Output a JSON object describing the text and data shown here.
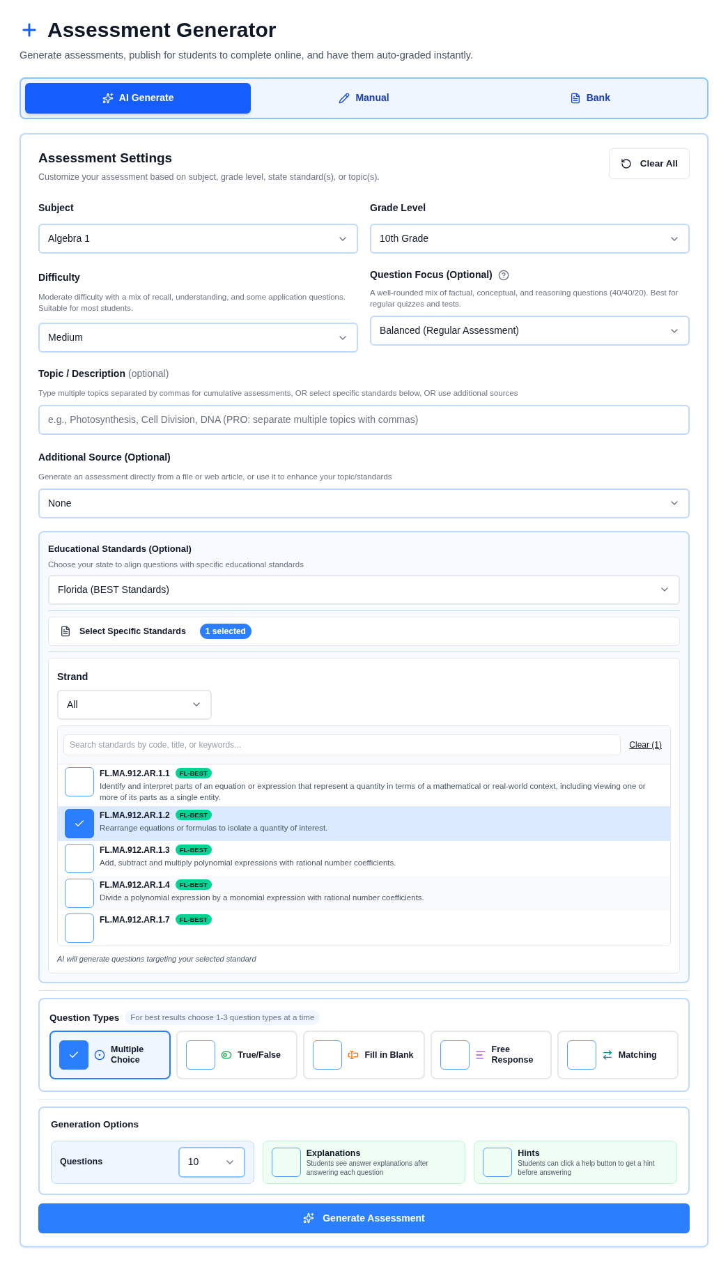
{
  "header": {
    "title": "Assessment Generator",
    "subtitle": "Generate assessments, publish for students to complete online, and have them auto-graded instantly."
  },
  "tabs": [
    {
      "label": "AI Generate",
      "kind": "ai",
      "selected": true
    },
    {
      "label": "Manual",
      "kind": "manual",
      "selected": false
    },
    {
      "label": "Bank",
      "kind": "bank",
      "selected": false
    }
  ],
  "settings": {
    "title": "Assessment Settings",
    "subtitle": "Customize your assessment based on subject, grade level, state standard(s), or topic(s).",
    "clear_button": "Clear All"
  },
  "subject": {
    "label": "Subject",
    "value": "Algebra 1"
  },
  "grade_level": {
    "label": "Grade Level",
    "value": "10th Grade"
  },
  "difficulty": {
    "label": "Difficulty",
    "description": "Moderate difficulty with a mix of recall, understanding, and some application questions. Suitable for most students.",
    "value": "Medium"
  },
  "question_focus": {
    "label": "Question Focus (Optional)",
    "description": "A well-rounded mix of factual, conceptual, and reasoning questions (40/40/20). Best for regular quizzes and tests.",
    "value": "Balanced (Regular Assessment)"
  },
  "topic": {
    "label": "Topic / Description",
    "hint": "(optional)",
    "description": "Type multiple topics separated by commas for cumulative assessments, OR select specific standards below, OR use additional sources",
    "placeholder": "e.g., Photosynthesis, Cell Division, DNA (PRO: separate multiple topics with commas)"
  },
  "additional_source": {
    "label": "Additional Source (Optional)",
    "description": "Generate an assessment directly from a file or web article, or use it to enhance your topic/standards",
    "value": "None"
  },
  "standards": {
    "title": "Educational Standards (Optional)",
    "description": "Choose your state to align questions with specific educational standards",
    "state": "Florida (BEST Standards)",
    "select_label": "Select Specific Standards",
    "selected_count": "1 selected",
    "strand_label": "Strand",
    "strand_value": "All",
    "search_placeholder": "Search standards by code, title, or keywords...",
    "clear_link": "Clear (1)",
    "items": [
      {
        "code": "FL.MA.912.AR.1.1",
        "tag": "FL-BEST",
        "description": "Identify and interpret parts of an equation or expression that represent a quantity in terms of a mathematical or real-world context, including viewing one or more of its parts as a single entity.",
        "selected": false
      },
      {
        "code": "FL.MA.912.AR.1.2",
        "tag": "FL-BEST",
        "description": "Rearrange equations or formulas to isolate a quantity of interest.",
        "selected": true
      },
      {
        "code": "FL.MA.912.AR.1.3",
        "tag": "FL-BEST",
        "description": "Add, subtract and multiply polynomial expressions with rational number coefficients.",
        "selected": false
      },
      {
        "code": "FL.MA.912.AR.1.4",
        "tag": "FL-BEST",
        "description": "Divide a polynomial expression by a monomial expression with rational number coefficients.",
        "selected": false
      },
      {
        "code": "FL.MA.912.AR.1.7",
        "tag": "FL-BEST",
        "selected": false
      }
    ],
    "footnote": "AI will generate questions targeting your selected standard"
  },
  "question_types": {
    "title": "Question Types",
    "hint": "For best results choose 1-3 question types at a time",
    "items": [
      {
        "label": "Multiple Choice",
        "kind": "multiple_choice",
        "selected": true
      },
      {
        "label": "True/False",
        "kind": "true_false",
        "selected": false
      },
      {
        "label": "Fill in Blank",
        "kind": "fill_blank",
        "selected": false
      },
      {
        "label": "Free Response",
        "kind": "free_response",
        "selected": false
      },
      {
        "label": "Matching",
        "kind": "matching",
        "selected": false
      }
    ]
  },
  "generation_options": {
    "title": "Generation Options",
    "questions_label": "Questions",
    "questions_value": "10",
    "toggles": [
      {
        "label": "Explanations",
        "description": "Students see answer explanations after answering each question",
        "checked": false
      },
      {
        "label": "Hints",
        "description": "Students can click a help button to get a hint before answering",
        "checked": false
      }
    ]
  },
  "generate_button": "Generate Assessment"
}
